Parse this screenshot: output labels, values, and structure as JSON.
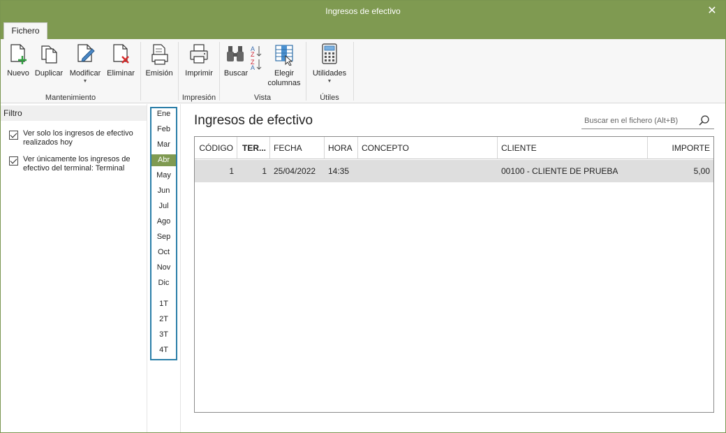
{
  "window": {
    "title": "Ingresos de efectivo",
    "close_glyph": "✕"
  },
  "tabs": [
    {
      "label": "Fichero"
    }
  ],
  "ribbon": {
    "groups": [
      {
        "label": "Mantenimiento",
        "buttons": [
          {
            "label": "Nuevo",
            "icon": "new-document-icon"
          },
          {
            "label": "Duplicar",
            "icon": "duplicate-icon"
          },
          {
            "label": "Modificar",
            "icon": "edit-document-icon",
            "dropdown": true
          },
          {
            "label": "Eliminar",
            "icon": "delete-document-icon"
          },
          {
            "label": "Emisión",
            "icon": "print-preview-icon"
          }
        ]
      },
      {
        "label": "Impresión",
        "buttons": [
          {
            "label": "Imprimir",
            "icon": "printer-icon"
          }
        ]
      },
      {
        "label": "Vista",
        "buttons": [
          {
            "label": "Buscar",
            "icon": "binoculars-icon"
          },
          {
            "label": "Elegir",
            "label2": "columnas",
            "icon": "choose-columns-icon"
          }
        ]
      },
      {
        "label": "Útiles",
        "buttons": [
          {
            "label": "Utilidades",
            "icon": "calculator-icon",
            "dropdown": true
          }
        ]
      }
    ]
  },
  "filter": {
    "title": "Filtro",
    "options": [
      {
        "label": "Ver solo los ingresos de efectivo realizados hoy",
        "checked": true
      },
      {
        "label": "Ver únicamente los ingresos de efectivo del terminal: Terminal",
        "checked": true
      }
    ]
  },
  "months": [
    "Ene",
    "Feb",
    "Mar",
    "Abr",
    "May",
    "Jun",
    "Jul",
    "Ago",
    "Sep",
    "Oct",
    "Nov",
    "Dic"
  ],
  "quarters": [
    "1T",
    "2T",
    "3T",
    "4T"
  ],
  "selected_month": "Abr",
  "main": {
    "title": "Ingresos de efectivo",
    "search_placeholder": "Buscar en el fichero (Alt+B)"
  },
  "table": {
    "columns": [
      "CÓDIGO",
      "TER...",
      "FECHA",
      "HORA",
      "CONCEPTO",
      "CLIENTE",
      "IMPORTE"
    ],
    "rows": [
      [
        "1",
        "1",
        "25/04/2022",
        "14:35",
        "",
        "00100 - CLIENTE DE PRUEBA",
        "5,00"
      ]
    ]
  },
  "colors": {
    "accent": "#7f9a51",
    "month_border": "#2a7ea8",
    "row_selected": "#dedede"
  }
}
